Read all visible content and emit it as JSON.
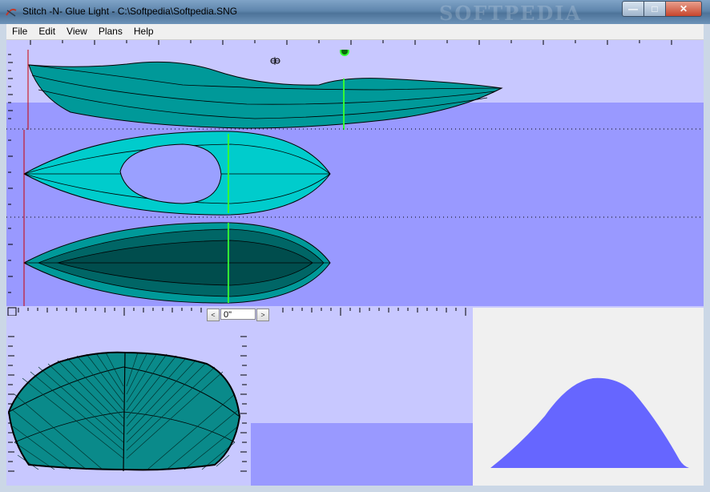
{
  "window": {
    "title": "Stitch -N- Glue Light - C:\\Softpedia\\Softpedia.SNG",
    "watermark": "SOFTPEDIA",
    "buttons": {
      "minimize": "—",
      "maximize": "□",
      "close": "✕"
    }
  },
  "menu": {
    "items": [
      {
        "label": "File"
      },
      {
        "label": "Edit"
      },
      {
        "label": "View"
      },
      {
        "label": "Plans"
      },
      {
        "label": "Help"
      }
    ]
  },
  "station_control": {
    "value": "0\"",
    "prev": "<",
    "next": ">"
  },
  "colors": {
    "hull_side": "#009999",
    "hull_top": "#00cccc",
    "hull_bottom": "#006666",
    "hull_bottom_dark": "#004d4d",
    "cockpit": "#9aa0ff",
    "station_line": "#33ff33",
    "ref_line": "#cc0000",
    "curve_fill": "#6666ff",
    "view_bg_light": "#c8c8ff",
    "view_bg_dark": "#9999ff"
  },
  "icons": [
    "app-icon",
    "move-cursor-icon",
    "station-handle-icon"
  ]
}
